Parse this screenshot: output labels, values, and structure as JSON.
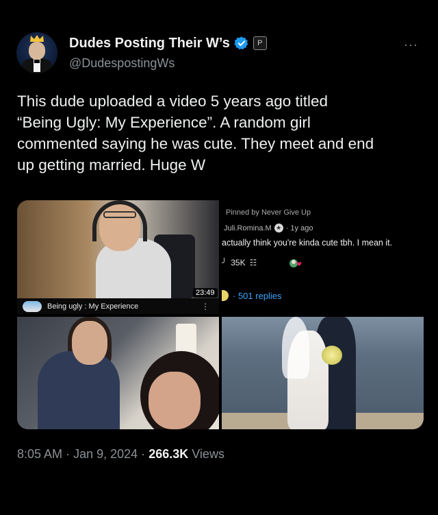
{
  "author": {
    "display_name": "Dudes Posting Their W’s",
    "handle": "@DudespostingWs",
    "badge_text": "P",
    "more_label": "···"
  },
  "tweet": {
    "lines": [
      "This dude uploaded a video 5 years ago titled",
      "“Being Ugly: My Experience”. A random girl",
      "commented saying he was cute. They meet and end",
      "up getting married. Huge W"
    ]
  },
  "video": {
    "duration": "23:49",
    "title": "Being ugly : My Experience",
    "menu": "⋮"
  },
  "comment": {
    "pinned": "Pinned by Never Give Up",
    "author": "Juli.Romina.M",
    "star": "★",
    "age": "· 1y ago",
    "text": "actually think you're kinda cute tbh. I mean it.",
    "likes": "35K",
    "replies": "· 501 replies"
  },
  "meta": {
    "time": "8:05 AM",
    "sep1": "·",
    "date": "Jan 9, 2024",
    "sep2": "·",
    "views_count": "266.3K",
    "views_label": "Views"
  },
  "colors": {
    "background": "#000000",
    "verified": "#1d9bf0",
    "replies_link": "#3ea6ff",
    "muted": "#8b9196"
  }
}
